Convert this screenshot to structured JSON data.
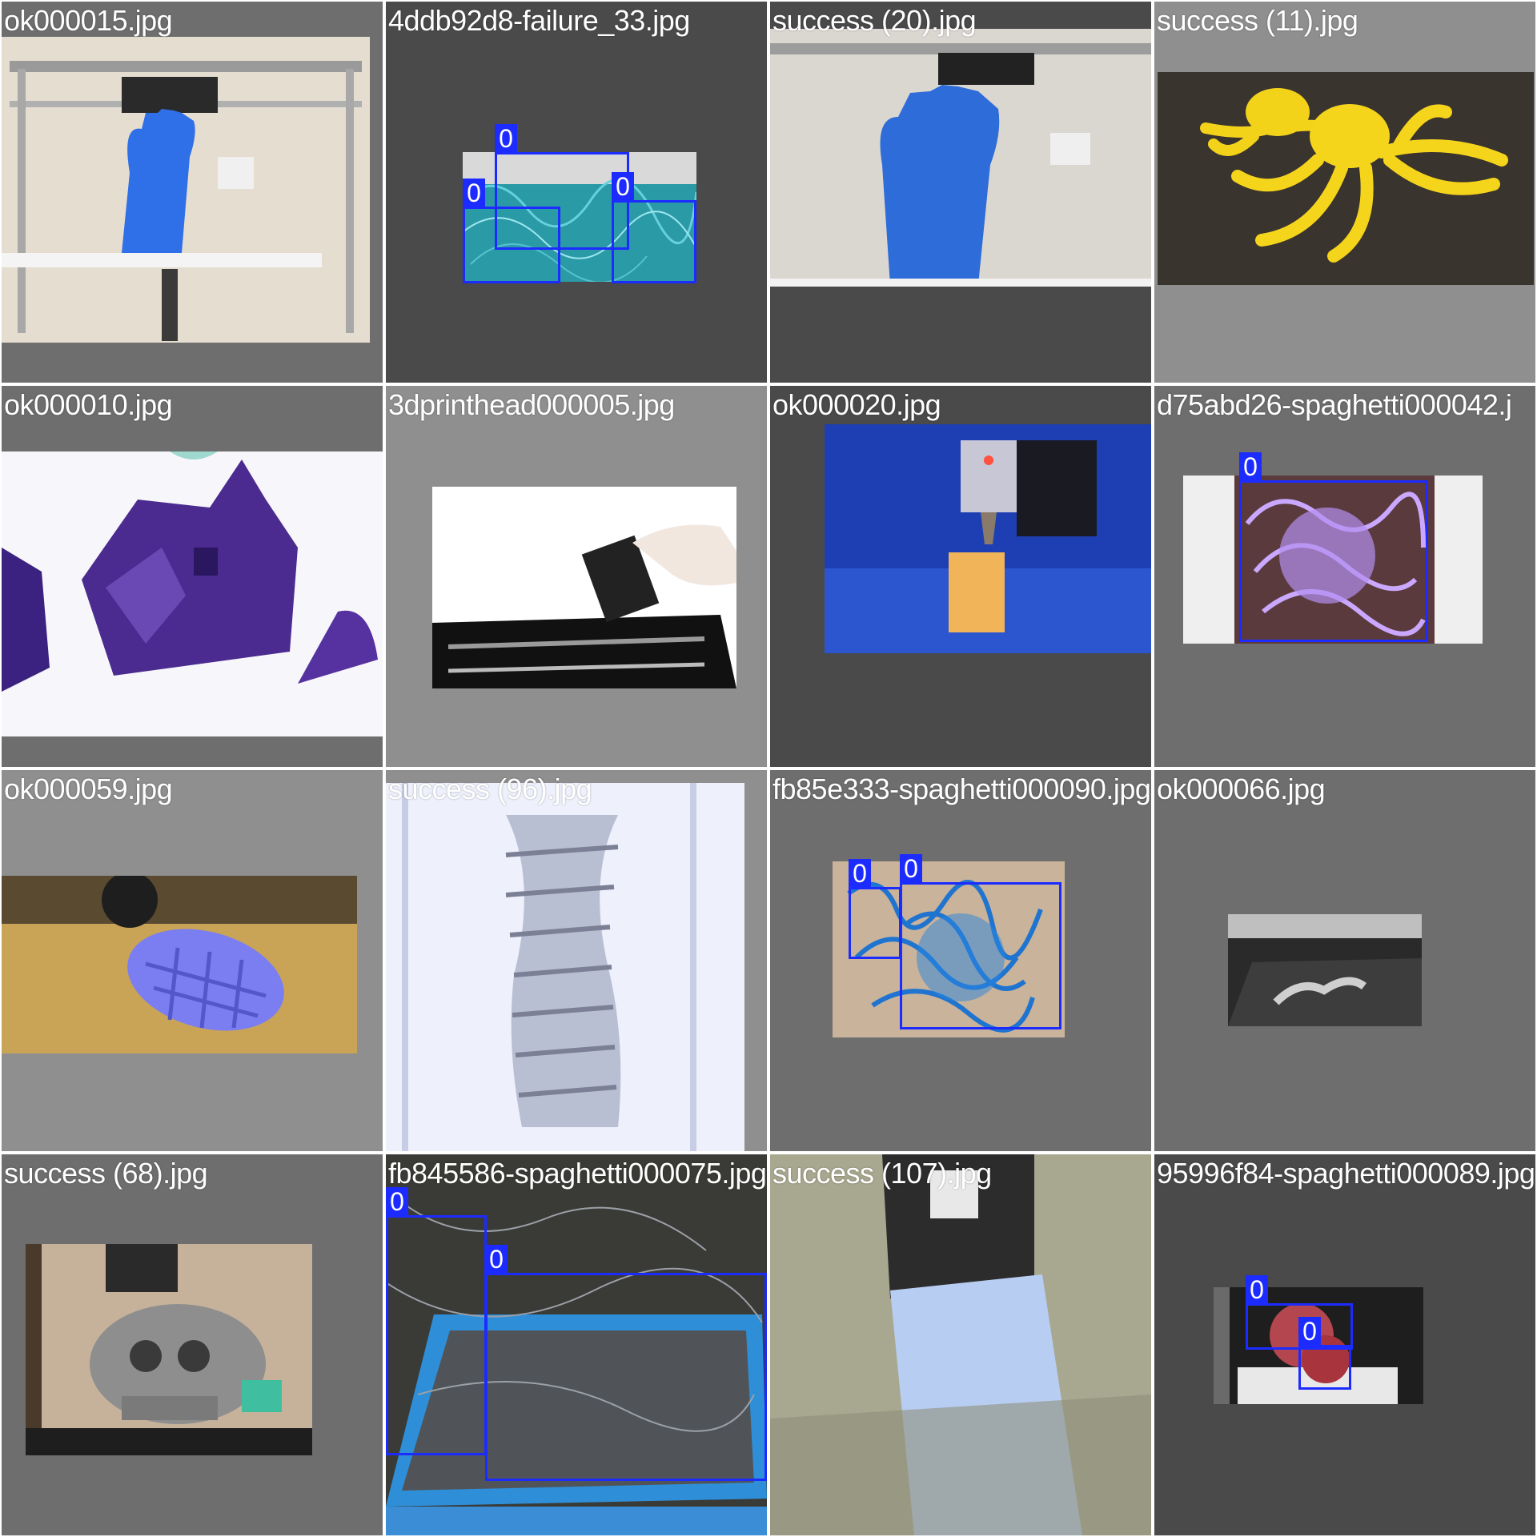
{
  "tiles": [
    {
      "label": "ok000015.jpg"
    },
    {
      "label": "4ddb92d8-failure_33.jpg",
      "boxes": [
        "0",
        "0",
        "0"
      ]
    },
    {
      "label": "success (20).jpg"
    },
    {
      "label": "success (11).jpg"
    },
    {
      "label": "ok000010.jpg"
    },
    {
      "label": "3dprinthead000005.jpg"
    },
    {
      "label": "ok000020.jpg"
    },
    {
      "label": "d75abd26-spaghetti000042.j",
      "boxes": [
        "0"
      ]
    },
    {
      "label": "ok000059.jpg"
    },
    {
      "label": "success (96).jpg"
    },
    {
      "label": "fb85e333-spaghetti000090.jpg",
      "boxes": [
        "0",
        "0"
      ]
    },
    {
      "label": "ok000066.jpg"
    },
    {
      "label": "success (68).jpg"
    },
    {
      "label": "fb845586-spaghetti000075.jpg",
      "boxes": [
        "0",
        "0"
      ]
    },
    {
      "label": "success (107).jpg"
    },
    {
      "label": "95996f84-spaghetti000089.jpg",
      "boxes": [
        "0",
        "0"
      ]
    }
  ]
}
